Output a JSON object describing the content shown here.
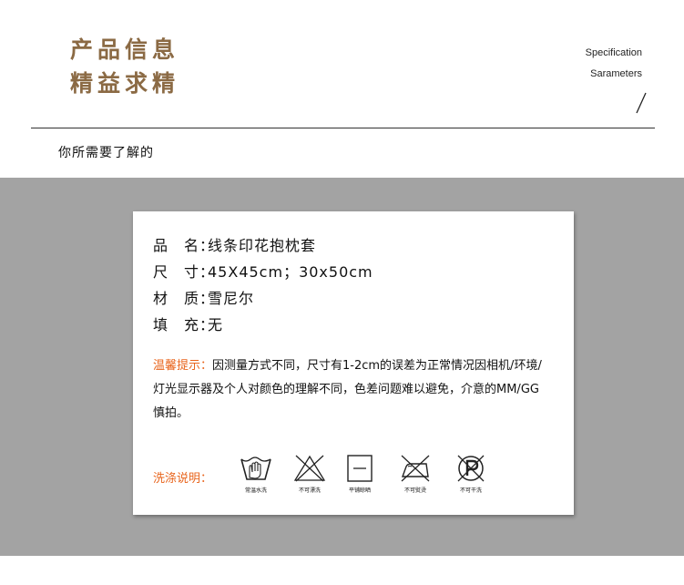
{
  "header": {
    "title_line1": "产品信息",
    "title_line2": "精益求精",
    "title_color": "#8b6a44",
    "en_line1": "Specification",
    "en_line2": "Sarameters",
    "subtitle": "你所需要了解的"
  },
  "card": {
    "specs": [
      {
        "key": "品　名：",
        "value": "线条印花抱枕套"
      },
      {
        "key": "尺　寸：",
        "value": "45X45cm；30x50cm"
      },
      {
        "key": "材　质：",
        "value": "雪尼尔"
      },
      {
        "key": "填　充：",
        "value": "无"
      }
    ],
    "note_label": "温馨提示：",
    "note_text": "因测量方式不同，尺寸有1-2cm的误差为正常情况因相机/环境/灯光显示器及个人对颜色的理解不同，色差问题难以避免，介意的MM/GG慎拍。",
    "accent_color": "#e8641c",
    "wash_label": "洗涤说明：",
    "care_icons": [
      {
        "icon": "hand-wash-icon",
        "caption": "常温水洗"
      },
      {
        "icon": "no-bleach-icon",
        "caption": "不可漂洗"
      },
      {
        "icon": "dry-flat-icon",
        "caption": "平铺晾晒"
      },
      {
        "icon": "no-iron-icon",
        "caption": "不可熨烫"
      },
      {
        "icon": "no-dry-clean-icon",
        "caption": "不可干洗"
      }
    ]
  },
  "colors": {
    "band": "#a3a3a3",
    "background": "#ffffff"
  }
}
